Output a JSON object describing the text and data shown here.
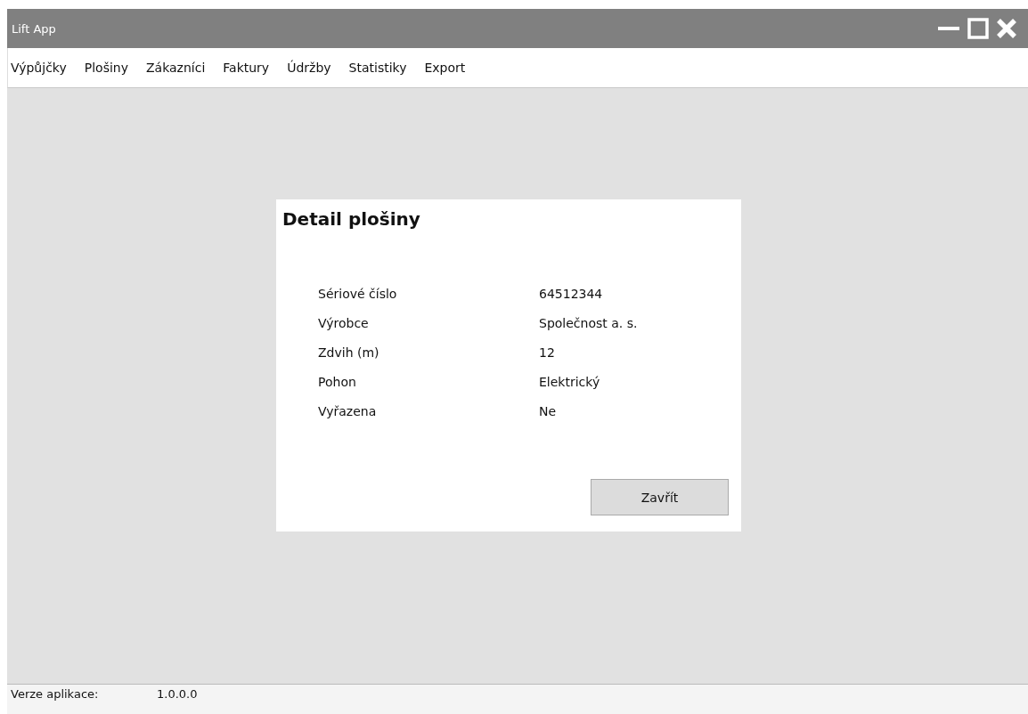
{
  "window": {
    "title": "Lift App"
  },
  "menu": [
    {
      "label": "Výpůjčky"
    },
    {
      "label": "Plošiny"
    },
    {
      "label": "Zákazníci"
    },
    {
      "label": "Faktury"
    },
    {
      "label": "Údržby"
    },
    {
      "label": "Statistiky"
    },
    {
      "label": "Export"
    }
  ],
  "dialog": {
    "title": "Detail plošiny",
    "fields": [
      {
        "label": "Sériové číslo",
        "value": "64512344"
      },
      {
        "label": "Výrobce",
        "value": "Společnost a. s."
      },
      {
        "label": "Zdvih (m)",
        "value": "12"
      },
      {
        "label": "Pohon",
        "value": "Elektrický"
      },
      {
        "label": "Vyřazena",
        "value": "Ne"
      }
    ],
    "button": "Zavřít"
  },
  "status_bar": {
    "label": "Verze aplikace:",
    "value": "1.0.0.0"
  }
}
